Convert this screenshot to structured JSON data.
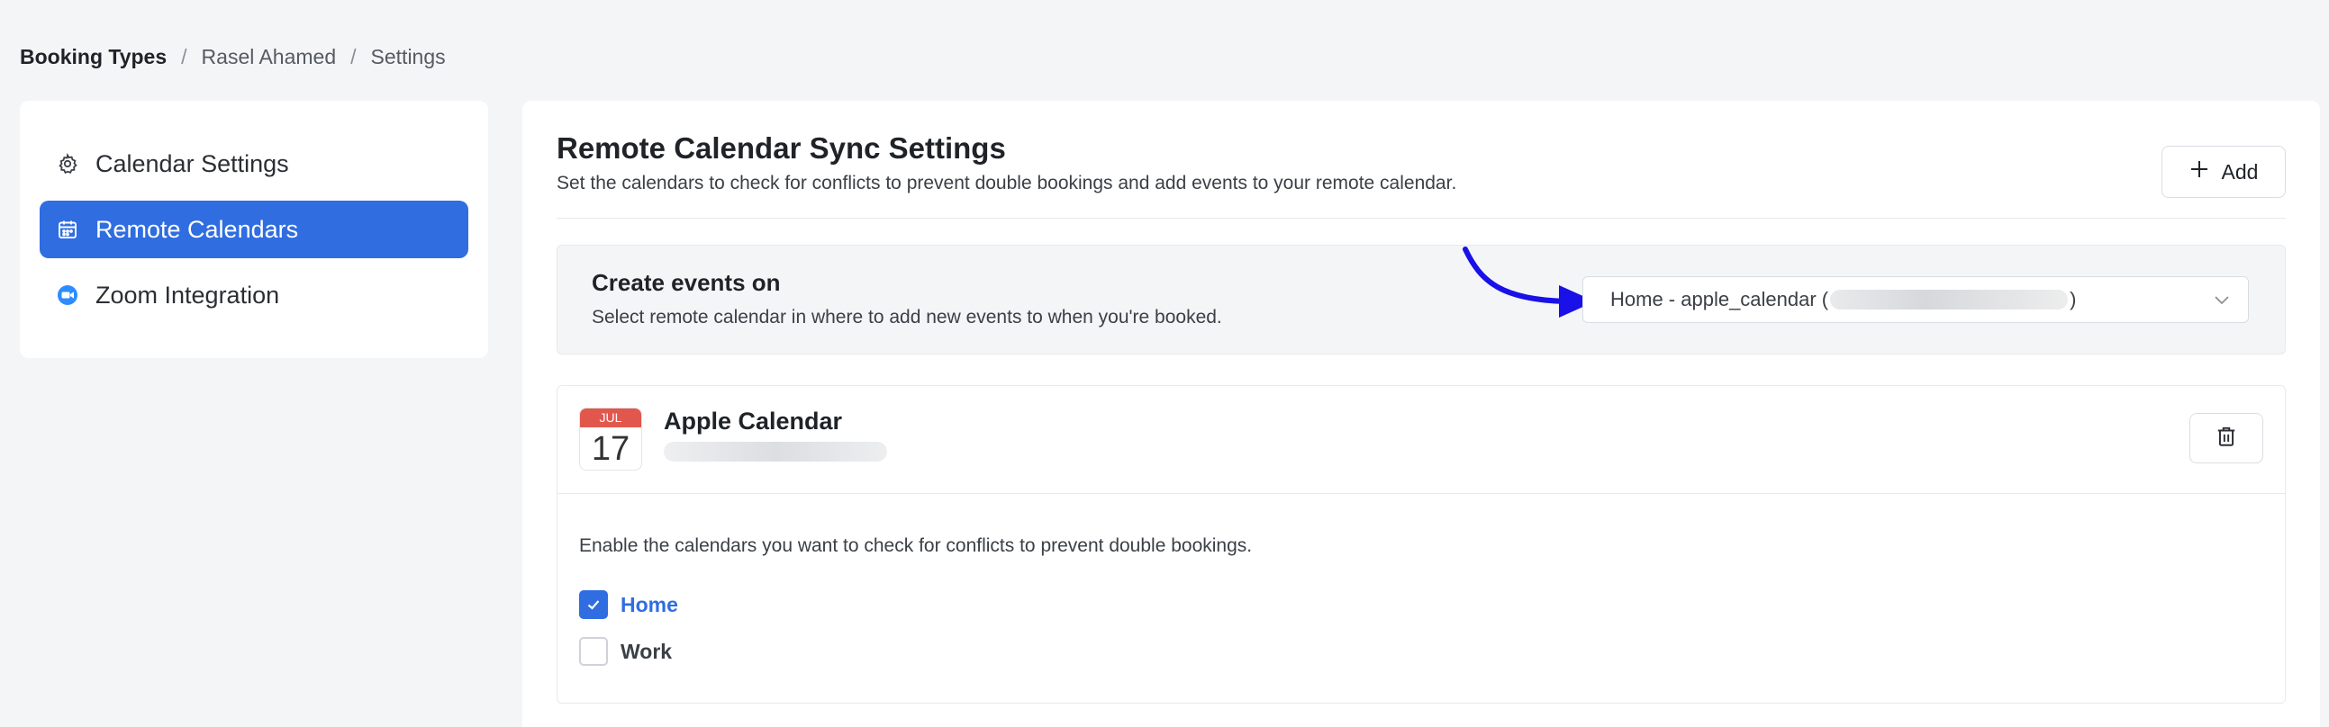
{
  "breadcrumb": {
    "root": "Booking Types",
    "separator": "/",
    "items": [
      "Rasel Ahamed",
      "Settings"
    ]
  },
  "sidebar": {
    "items": [
      {
        "label": "Calendar Settings",
        "icon": "gear-icon",
        "active": false
      },
      {
        "label": "Remote Calendars",
        "icon": "calendar-icon",
        "active": true
      },
      {
        "label": "Zoom Integration",
        "icon": "zoom-icon",
        "active": false
      }
    ]
  },
  "main": {
    "title": "Remote Calendar Sync Settings",
    "description": "Set the calendars to check for conflicts to prevent double bookings and add events to your remote calendar.",
    "add_label": "Add"
  },
  "create_events": {
    "title": "Create events on",
    "description": "Select remote calendar in where to add new events to when you're booked.",
    "select_prefix": "Home - apple_calendar (",
    "select_suffix": ")"
  },
  "calendar_card": {
    "icon_month": "JUL",
    "icon_day": "17",
    "name": "Apple Calendar",
    "conflict_text": "Enable the calendars you want to check for conflicts to prevent double bookings.",
    "calendars": [
      {
        "label": "Home",
        "checked": true
      },
      {
        "label": "Work",
        "checked": false
      }
    ]
  },
  "colors": {
    "accent": "#2f6de1",
    "annotation_arrow": "#1a10e8",
    "calendar_red": "#e2574c"
  }
}
